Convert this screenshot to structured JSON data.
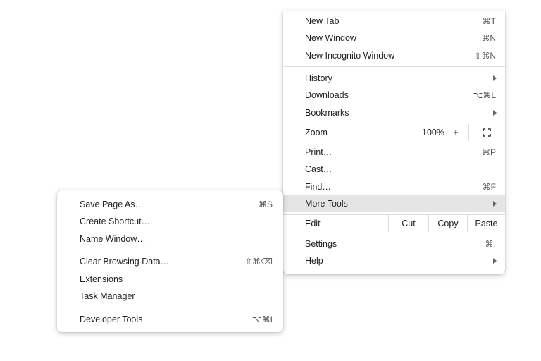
{
  "main_menu": {
    "new_tab": {
      "label": "New Tab",
      "shortcut": "⌘T"
    },
    "new_window": {
      "label": "New Window",
      "shortcut": "⌘N"
    },
    "new_incognito": {
      "label": "New Incognito Window",
      "shortcut": "⇧⌘N"
    },
    "history": {
      "label": "History"
    },
    "downloads": {
      "label": "Downloads",
      "shortcut": "⌥⌘L"
    },
    "bookmarks": {
      "label": "Bookmarks"
    },
    "zoom": {
      "label": "Zoom",
      "minus": "–",
      "value": "100%",
      "plus": "+",
      "fullscreen_icon": "fullscreen-icon"
    },
    "print": {
      "label": "Print…",
      "shortcut": "⌘P"
    },
    "cast": {
      "label": "Cast…"
    },
    "find": {
      "label": "Find…",
      "shortcut": "⌘F"
    },
    "more_tools": {
      "label": "More Tools"
    },
    "edit": {
      "label": "Edit",
      "cut": "Cut",
      "copy": "Copy",
      "paste": "Paste"
    },
    "settings": {
      "label": "Settings",
      "shortcut": "⌘,"
    },
    "help": {
      "label": "Help"
    }
  },
  "sub_menu": {
    "save_page": {
      "label": "Save Page As…",
      "shortcut": "⌘S"
    },
    "create_shortcut": {
      "label": "Create Shortcut…"
    },
    "name_window": {
      "label": "Name Window…"
    },
    "clear_browsing": {
      "label": "Clear Browsing Data…",
      "shortcut": "⇧⌘⌫"
    },
    "extensions": {
      "label": "Extensions"
    },
    "task_manager": {
      "label": "Task Manager"
    },
    "developer_tools": {
      "label": "Developer Tools",
      "shortcut": "⌥⌘I"
    }
  },
  "colors": {
    "highlight": "#e5e5e5",
    "separator": "#dcdcdc"
  }
}
